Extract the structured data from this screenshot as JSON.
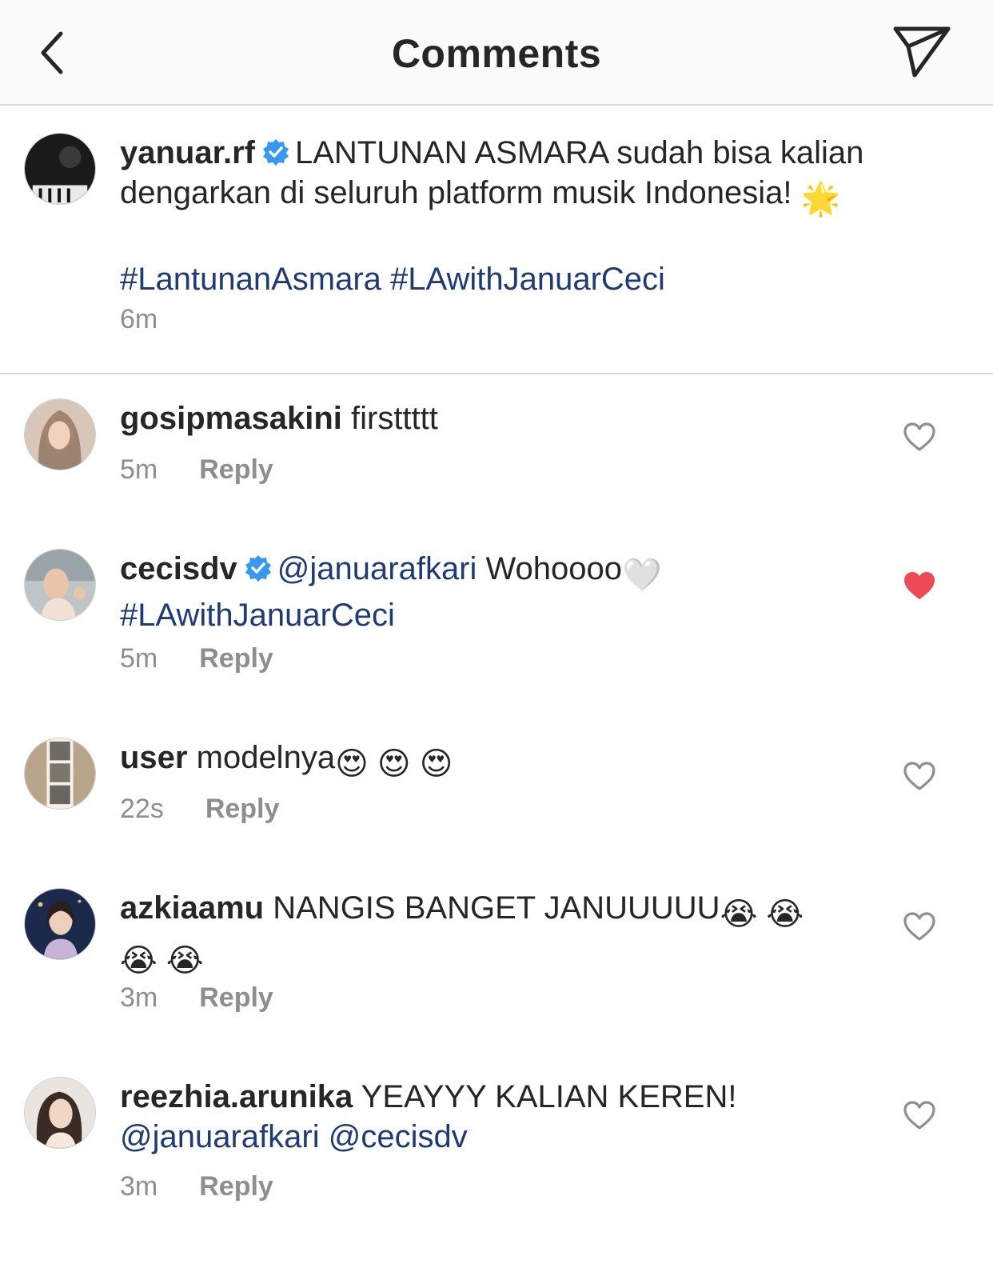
{
  "header": {
    "title": "Comments",
    "back_icon": "chevron-left-icon",
    "share_icon": "paper-plane-icon"
  },
  "caption": {
    "username": "yanuar.rf",
    "verified": true,
    "text": "LANTUNAN ASMARA sudah bisa kalian dengarkan di seluruh platform musik Indonesia!",
    "emoji": "🌟",
    "hashtags": "#LantunanAsmara #LAwithJanuarCeci",
    "time": "6m"
  },
  "comments": [
    {
      "username": "gosipmasakini",
      "text": "firsttttt",
      "time": "5m",
      "reply": "Reply",
      "liked": false
    },
    {
      "username": "cecisdv",
      "verified": true,
      "mention": "@januarafkari",
      "text": "Wohoooo",
      "emoji_after": "🤍",
      "hashtag": "#LAwithJanuarCeci",
      "time": "5m",
      "reply": "Reply",
      "liked": true
    },
    {
      "username": "user",
      "text": "modelnya",
      "emoji": "😍 😍 😍",
      "time": "22s",
      "reply": "Reply",
      "liked": false
    },
    {
      "username": "azkiaamu",
      "text": "NANGIS BANGET JANUUUUU",
      "emoji": "😭 😭",
      "emoji_line2": "😭 😭",
      "time": "3m",
      "reply": "Reply",
      "liked": false
    },
    {
      "username": "reezhia.arunika",
      "text": "YEAYYY KALIAN KEREN!",
      "mentions": "@januarafkari @cecisdv",
      "time": "3m",
      "reply": "Reply",
      "liked": false
    }
  ],
  "colors": {
    "link": "#1f3b72",
    "meta": "#8e8e8e",
    "like_active": "#ed4956",
    "verified": "#3897f0"
  }
}
